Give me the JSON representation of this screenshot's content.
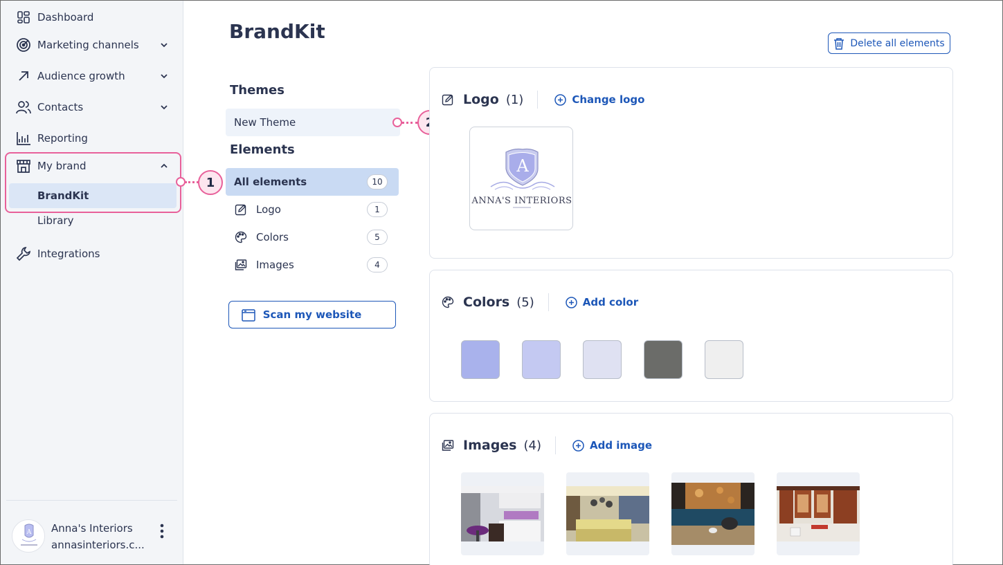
{
  "sidebar": {
    "items": [
      {
        "label": "Dashboard",
        "icon": "dashboard-icon"
      },
      {
        "label": "Marketing channels",
        "icon": "target-icon"
      },
      {
        "label": "Audience growth",
        "icon": "arrow-up-right-icon"
      },
      {
        "label": "Contacts",
        "icon": "people-icon"
      },
      {
        "label": "Reporting",
        "icon": "chart-icon"
      },
      {
        "label": "My brand",
        "icon": "store-icon"
      },
      {
        "label": "Integrations",
        "icon": "wrench-icon"
      }
    ],
    "sub_items": [
      {
        "label": "BrandKit"
      },
      {
        "label": "Library"
      }
    ],
    "account": {
      "name": "Anna's Interiors",
      "domain": "annasinteriors.c..."
    }
  },
  "callouts": [
    "1",
    "2"
  ],
  "page": {
    "title": "BrandKit",
    "delete_all_label": "Delete all elements"
  },
  "themes": {
    "heading": "Themes",
    "items": [
      "New Theme"
    ]
  },
  "elements": {
    "heading": "Elements",
    "items": [
      {
        "label": "All elements",
        "count": "10"
      },
      {
        "label": "Logo",
        "count": "1"
      },
      {
        "label": "Colors",
        "count": "5"
      },
      {
        "label": "Images",
        "count": "4"
      }
    ],
    "scan_label": "Scan my website"
  },
  "logo_card": {
    "title": "Logo",
    "count": "(1)",
    "action": "Change logo",
    "logo_letter": "A",
    "logo_text": "ANNA'S INTERIORS"
  },
  "colors_card": {
    "title": "Colors",
    "count": "(5)",
    "action": "Add color",
    "swatches": [
      "#a9b2ec",
      "#c4c9f2",
      "#dfe1f2",
      "#6b6c69",
      "#efefef"
    ]
  },
  "images_card": {
    "title": "Images",
    "count": "(4)",
    "action": "Add image"
  },
  "colors": {
    "accent": "#1d57b8",
    "highlight": "#e8609a",
    "active_bg": "#c9daf3"
  }
}
